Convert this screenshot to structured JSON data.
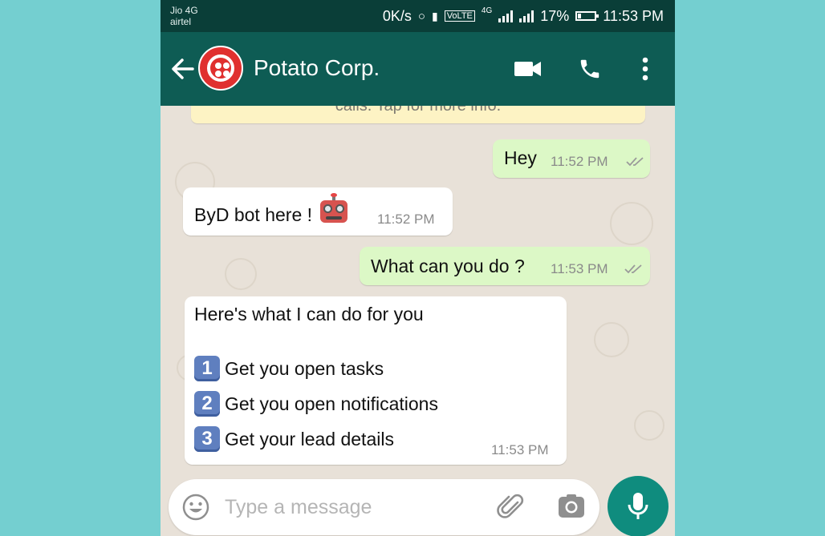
{
  "status_bar": {
    "carrier_1": "Jio 4G",
    "carrier_2": "airtel",
    "network_speed": "0K/s",
    "volte": "VoLTE",
    "network_type": "4G",
    "battery_percent": "17%",
    "time": "11:53 PM"
  },
  "header": {
    "title": "Potato Corp.",
    "back_icon": "back-arrow-icon",
    "video_icon": "video-call-icon",
    "call_icon": "phone-call-icon",
    "menu_icon": "more-vert-icon"
  },
  "chat": {
    "notice": "calls. Tap for more info.",
    "messages": [
      {
        "direction": "out",
        "text": "Hey",
        "time": "11:52 PM"
      },
      {
        "direction": "in",
        "text": "ByD bot here !",
        "emoji": "robot-face-icon",
        "time": "11:52 PM"
      },
      {
        "direction": "out",
        "text": "What can you do ?",
        "time": "11:53 PM"
      },
      {
        "direction": "in",
        "text": "Here's what I can do for you",
        "options": [
          {
            "num": "1",
            "label": "Get you open tasks"
          },
          {
            "num": "2",
            "label": "Get you open notifications"
          },
          {
            "num": "3",
            "label": "Get your lead details"
          }
        ],
        "time": "11:53 PM"
      }
    ]
  },
  "composer": {
    "placeholder": "Type a message",
    "emoji_icon": "emoji-icon",
    "attach_icon": "paperclip-icon",
    "camera_icon": "camera-icon",
    "mic_icon": "mic-icon"
  },
  "colors": {
    "status_bar": "#0a3e38",
    "header": "#0e5c54",
    "outgoing_bubble": "#dcf8c6",
    "incoming_bubble": "#ffffff",
    "mic_button": "#0f8c7e",
    "page_background": "#74cfd0"
  }
}
